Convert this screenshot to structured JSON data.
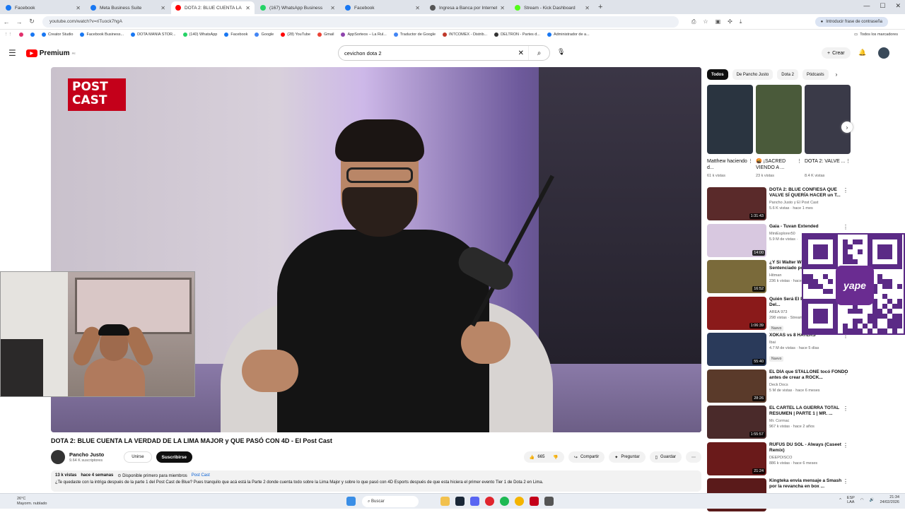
{
  "browser": {
    "tabs": [
      {
        "title": "Facebook",
        "color": "#1877f2",
        "active": false
      },
      {
        "title": "Meta Business Suite",
        "color": "#1877f2",
        "active": false
      },
      {
        "title": "DOTA 2: BLUE CUENTA LA",
        "color": "#ff0000",
        "active": true
      },
      {
        "title": "(167) WhatsApp Business",
        "color": "#25d366",
        "active": false
      },
      {
        "title": "Facebook",
        "color": "#1877f2",
        "active": false
      },
      {
        "title": "Ingresa a Banca por Internet |",
        "color": "#555555",
        "active": false
      },
      {
        "title": "Stream - Kick Dashboard",
        "color": "#53fc18",
        "active": false
      }
    ],
    "new_tab": "+",
    "url": "youtube.com/watch?v=riTuock7hgA",
    "profile_pill": "Introducir frase de contraseña",
    "bookmarks": [
      {
        "label": "",
        "color": "#e1306c"
      },
      {
        "label": "",
        "color": "#1877f2"
      },
      {
        "label": "Creator Studio",
        "color": "#1877f2"
      },
      {
        "label": "Facebook Business...",
        "color": "#1877f2"
      },
      {
        "label": "DOTA MANIA STOR...",
        "color": "#1877f2"
      },
      {
        "label": "(140) WhatsApp",
        "color": "#25d366"
      },
      {
        "label": "Facebook",
        "color": "#1877f2"
      },
      {
        "label": "Google",
        "color": "#4285f4"
      },
      {
        "label": "(28) YouTube",
        "color": "#ff0000"
      },
      {
        "label": "Gmail",
        "color": "#ea4335"
      },
      {
        "label": "AppSorteos – La Rul...",
        "color": "#8e44ad"
      },
      {
        "label": "Traductor de Google",
        "color": "#4285f4"
      },
      {
        "label": "INTCOMEX - Distrib...",
        "color": "#c0392b"
      },
      {
        "label": "DELTRON - Partes d...",
        "color": "#333333"
      },
      {
        "label": "Administrador de a...",
        "color": "#1877f2"
      }
    ],
    "all_bookmarks": "Todos los marcadores"
  },
  "youtube": {
    "logo": "Premium",
    "logo_region": "PE",
    "search_value": "cevichon dota 2",
    "create_label": "Crear"
  },
  "video": {
    "overlay_logo": "POST CAST",
    "title": "DOTA 2: BLUE CUENTA LA VERDAD DE LA LIMA MAJOR y QUE PASÓ CON 4D - El Post Cast",
    "channel": "Pancho Justo",
    "subscribers": "9.64 K suscriptores",
    "join_label": "Unirse",
    "subscribe_label": "Suscribirse",
    "likes": "665",
    "share_label": "Compartir",
    "ask_label": "Preguntar",
    "save_label": "Guardar",
    "views": "13 k vistas",
    "age": "hace 4 semanas",
    "members_first": "Disponible primero para miembros",
    "tag": "Post Cast",
    "description": "¿Te quedaste con la intriga después de la parte 1 del Post Cast de Blue? Pues tranquilo que acá está la Parte 2 donde cuenta todo sobre la Lima Major y sobre lo que pasó con 4D Esports después de que esta hiciera el primer evento Tier 1 de Dota 2 en Lima."
  },
  "chips": [
    "Todos",
    "De Pancho Justo",
    "Dota 2",
    "Pódcasts"
  ],
  "shorts": [
    {
      "title": "Matthew haciendo d...",
      "views": "61 k vistas",
      "color": "#2a3440"
    },
    {
      "title": "🤬 ¡SACRED VIENDO A ...",
      "views": "23 k vistas",
      "color": "#4a5a3a"
    },
    {
      "title": "DOTA 2: VALVE ...",
      "views": "8.4 K vistas",
      "color": "#3a3a48"
    }
  ],
  "recommendations": [
    {
      "title": "DOTA 2: BLUE CONFIESA QUE VALVE SÍ QUERÍA HACER un T...",
      "channel": "Pancho Justo y El Post Cast",
      "meta": "5.6 K vistas · hace 1 mes",
      "duration": "1:31:43",
      "color": "#5a2a2a",
      "badge": ""
    },
    {
      "title": "Gaia - Tuvan Extended",
      "channel": "MiniExplorer50",
      "meta": "5.9 M de vistas · ",
      "duration": "14:00",
      "color": "#d8c8e0",
      "badge": ""
    },
    {
      "title": "¿Y Si Walter White Fuera Sentenciado por...",
      "channel": "Hitman",
      "meta": "236 k vistas · hace ...",
      "duration": "16:52",
      "color": "#7a6a3a",
      "badge": ""
    },
    {
      "title": "Quién Será El Próximo Presidente Del...",
      "channel": "AREA 973",
      "meta": "298 vistas · Stream...",
      "duration": "1:06:39",
      "color": "#8a1a1a",
      "badge": "Nuevo"
    },
    {
      "title": "XOKAS vs 8 HATERS",
      "channel": "Ibai",
      "meta": "4.7 M de vistas · hace 5 días",
      "duration": "55:40",
      "color": "#2a3a5a",
      "badge": "Nuevo"
    },
    {
      "title": "EL DÍA que STALLONE tocó FONDO antes de crear a ROCK...",
      "channel": "Deck Docs",
      "meta": "5 M de vistas · hace 6 meses",
      "duration": "28:26",
      "color": "#5a3a2a",
      "badge": ""
    },
    {
      "title": "EL CARTEL LA GUERRA TOTAL RESUMEN | PARTE 1 | MR. ...",
      "channel": "Mr. Cormac",
      "meta": "967 k vistas · hace 2 años",
      "duration": "1:55:57",
      "color": "#4a2a2a",
      "badge": ""
    },
    {
      "title": "RÜFÜS DU SOL - Always (Caseet Remix)",
      "channel": "DEEPDISCO",
      "meta": "886 k vistas · hace 6 meses",
      "duration": "21:24",
      "color": "#6a1a1a",
      "badge": ""
    },
    {
      "title": "Kingteka envia mensaje a Smash por la revancha en box ...",
      "channel": "",
      "meta": "",
      "duration": "",
      "color": "#5a1a1a",
      "badge": ""
    }
  ],
  "qr_logo": "yape",
  "taskbar": {
    "weather_temp": "26°C",
    "weather_desc": "Mayorm. nublado",
    "search": "Buscar",
    "lang1": "ESP",
    "lang2": "LAA",
    "time": "21:34",
    "date": "24/02/2026"
  }
}
